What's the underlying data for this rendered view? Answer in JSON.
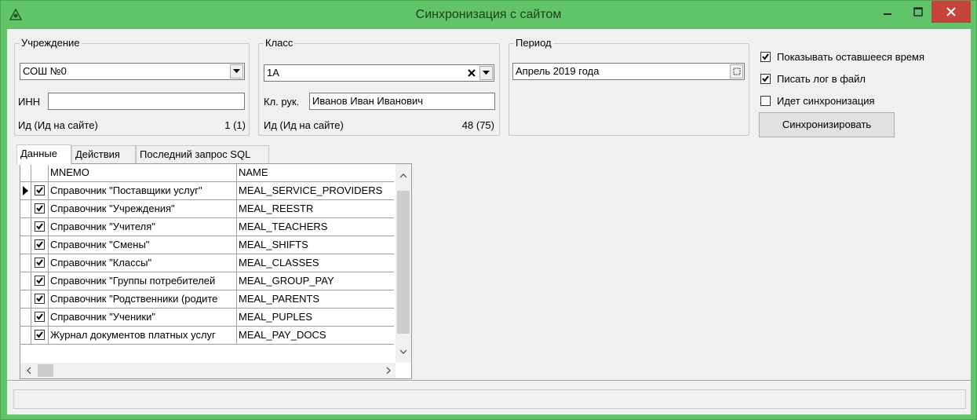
{
  "window": {
    "title": "Синхронизация с сайтом"
  },
  "institution": {
    "legend": "Учреждение",
    "value": "СОШ №0",
    "inn_label": "ИНН",
    "inn_value": "",
    "id_label": "Ид (Ид на сайте)",
    "id_value": "1 (1)"
  },
  "class": {
    "legend": "Класс",
    "value": "1А",
    "teacher_label": "Кл. рук.",
    "teacher_value": "Иванов Иван Иванович",
    "id_label": "Ид (Ид на сайте)",
    "id_value": "48 (75)"
  },
  "period": {
    "legend": "Период",
    "value": "Апрель 2019 года"
  },
  "options": [
    {
      "label": "Показывать оставшееся время",
      "checked": true
    },
    {
      "label": "Писать лог в файл",
      "checked": true
    },
    {
      "label": "Идет синхронизация",
      "checked": false
    }
  ],
  "sync_button": "Синхронизировать",
  "tabs": [
    {
      "label": "Данные",
      "active": true
    },
    {
      "label": "Действия",
      "active": false
    },
    {
      "label": "Последний запрос SQL",
      "active": false
    }
  ],
  "grid": {
    "columns": {
      "mnemo": "MNEMO",
      "name": "NAME"
    },
    "rows": [
      {
        "mnemo": "Справочник \"Поставщики услуг\"",
        "name": "MEAL_SERVICE_PROVIDERS",
        "checked": true,
        "current": true
      },
      {
        "mnemo": "Справочник \"Учреждения\"",
        "name": "MEAL_REESTR",
        "checked": true,
        "current": false
      },
      {
        "mnemo": "Справочник \"Учителя\"",
        "name": "MEAL_TEACHERS",
        "checked": true,
        "current": false
      },
      {
        "mnemo": "Справочник \"Смены\"",
        "name": "MEAL_SHIFTS",
        "checked": true,
        "current": false
      },
      {
        "mnemo": "Справочник \"Классы\"",
        "name": "MEAL_CLASSES",
        "checked": true,
        "current": false
      },
      {
        "mnemo": "Справочник \"Группы потребителей",
        "name": "MEAL_GROUP_PAY",
        "checked": true,
        "current": false
      },
      {
        "mnemo": "Справочник \"Родственники (родите",
        "name": "MEAL_PARENTS",
        "checked": true,
        "current": false
      },
      {
        "mnemo": "Справочник \"Ученики\"",
        "name": "MEAL_PUPLES",
        "checked": true,
        "current": false
      },
      {
        "mnemo": "Журнал документов платных услуг",
        "name": "MEAL_PAY_DOCS",
        "checked": true,
        "current": false
      }
    ]
  },
  "colors": {
    "titlebar": "#62c468",
    "close": "#c7423a",
    "face": "#f0f0f0"
  }
}
